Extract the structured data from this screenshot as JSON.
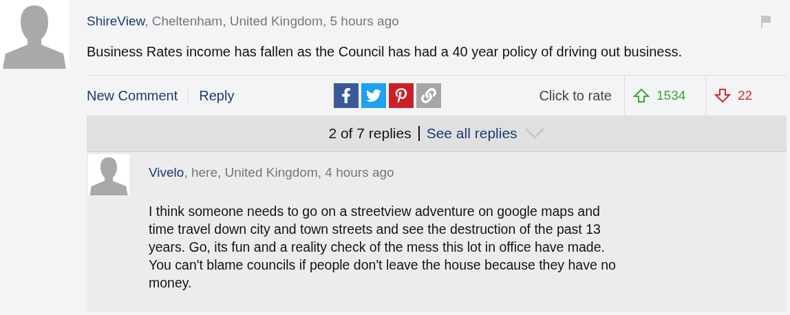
{
  "comment": {
    "author": "ShireView",
    "meta": ", Cheltenham, United Kingdom, 5 hours ago",
    "text": "Business Rates income has fallen as the Council has had a 40 year policy of driving out business.",
    "flagged": false
  },
  "actions": {
    "links": [
      "New Comment",
      "Reply"
    ],
    "share": [
      {
        "kind": "facebook",
        "color": "#3b5998"
      },
      {
        "kind": "twitter",
        "color": "#1da1f2"
      },
      {
        "kind": "pinterest",
        "color": "#cb2027"
      },
      {
        "kind": "link",
        "color": "#a6a6a6"
      }
    ],
    "rate_label": "Click to rate",
    "votes": [
      {
        "kind": "up",
        "count": "1534"
      },
      {
        "kind": "down",
        "count": "22"
      }
    ]
  },
  "replies_bar": {
    "count": "2 of 7 replies",
    "see_all": "See all replies",
    "expanded": false
  },
  "replies": [
    {
      "author": "Vivelo",
      "meta": ", here, United Kingdom, 4 hours ago",
      "text": "I think someone needs to go on a streetview adventure on google maps and time travel down city and town streets and see the destruction of the past 13 years. Go, its fun and a reality check of the mess this lot in office have made. You can't blame councils if people don't leave the house because they have no money."
    }
  ]
}
